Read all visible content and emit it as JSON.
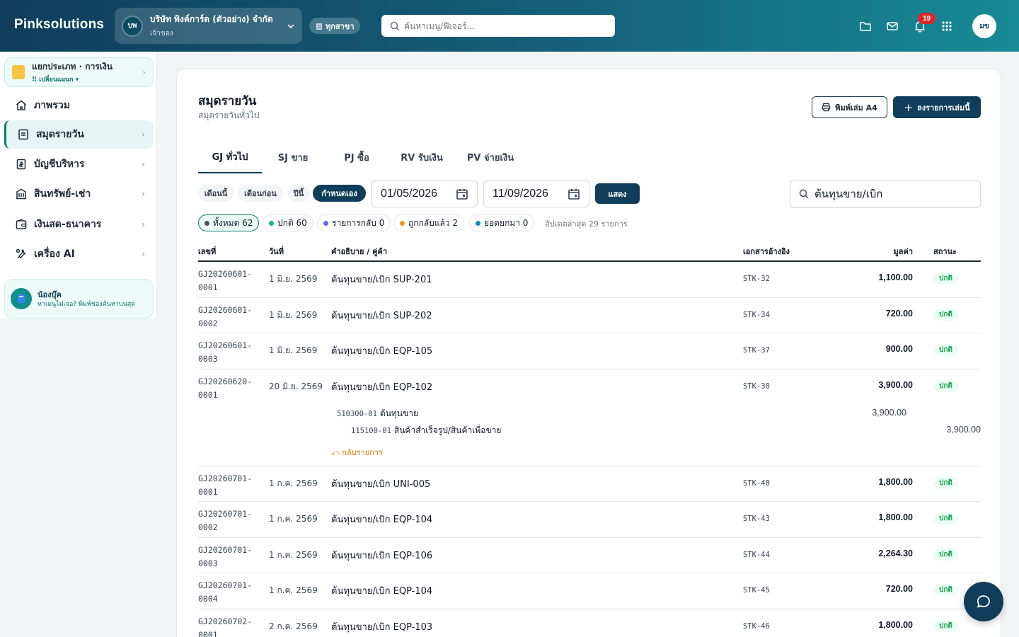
{
  "header": {
    "brand": "Pinksolutions",
    "company": {
      "badge": "บพ",
      "name": "บริษัท พิงค์การ์ด (ตัวอย่าง) จำกัด",
      "role": "เจ้าของ"
    },
    "branch_label": "ทุกสาขา",
    "search_placeholder": "ค้นหาเมนู/ฟีเจอร์...",
    "notification_count": "19",
    "avatar": "มข"
  },
  "sidebar": {
    "ledger": {
      "title": "แยกประเภท · การเงิน",
      "subtitle": "⠿ เปลี่ยนแผนก ▾"
    },
    "items": [
      {
        "label": "ภาพรวม",
        "icon": "home-icon",
        "active": false,
        "arrow": false
      },
      {
        "label": "สมุดรายวัน",
        "icon": "journal-icon",
        "active": true,
        "arrow": true
      },
      {
        "label": "บัญชีบริหาร",
        "icon": "ledger-icon",
        "active": false,
        "arrow": true
      },
      {
        "label": "สินทรัพย์-เช่า",
        "icon": "building-icon",
        "active": false,
        "arrow": true
      },
      {
        "label": "เงินสด-ธนาคาร",
        "icon": "wallet-icon",
        "active": false,
        "arrow": true
      },
      {
        "label": "เครื่อง AI",
        "icon": "tools-icon",
        "active": false,
        "arrow": true
      }
    ],
    "helper": {
      "title": "น้องบุ๊ค",
      "text": "หาเมนูไม่เจอ? พิมพ์ช่องค้นหาบนสุด"
    }
  },
  "main": {
    "title": "สมุดรายวัน",
    "subtitle": "สมุดรายวันทั่วไป",
    "print_label": "พิมพ์เล่ม A4",
    "add_label": "ลงรายการเล่มนี้",
    "tabs": [
      "GJ ทั่วไป",
      "SJ ขาย",
      "PJ ซื้อ",
      "RV รับเงิน",
      "PV จ่ายเงิน"
    ],
    "period_chips": [
      "เดือนนี้",
      "เดือนก่อน",
      "ปีนี้",
      "กำหนดเอง"
    ],
    "date_from": "01/05/2026",
    "date_to": "11/09/2026",
    "show_label": "แสดง",
    "search_value": "ต้นทุนขาย/เบิก",
    "status_filters": [
      {
        "label": "ทั้งหมด 62",
        "color": "#4b5563"
      },
      {
        "label": "ปกติ 60",
        "color": "#10b981"
      },
      {
        "label": "รายการกลับ 0",
        "color": "#6366f1"
      },
      {
        "label": "ถูกกลับแล้ว 2",
        "color": "#f59e0b"
      },
      {
        "label": "ยอดยกมา 0",
        "color": "#0891b2"
      }
    ],
    "updated_text": "อัปเดตล่าสุด 29 รายการ",
    "columns": {
      "no": "เลขที่",
      "date": "วันที่",
      "desc": "คำอธิบาย / คู่ค้า",
      "ref": "เอกสารอ้างอิง",
      "amount": "มูลค่า",
      "status": "สถานะ"
    },
    "rows": [
      {
        "no1": "GJ20260601-",
        "no2": "0001",
        "date": "1 มิ.ย. 2569",
        "desc": "ต้นทุนขาย/เบิก SUP-201",
        "ref": "STK-32",
        "amount": "1,100.00",
        "status": "ปกติ"
      },
      {
        "no1": "GJ20260601-",
        "no2": "0002",
        "date": "1 มิ.ย. 2569",
        "desc": "ต้นทุนขาย/เบิก SUP-202",
        "ref": "STK-34",
        "amount": "720.00",
        "status": "ปกติ"
      },
      {
        "no1": "GJ20260601-",
        "no2": "0003",
        "date": "1 มิ.ย. 2569",
        "desc": "ต้นทุนขาย/เบิก EQP-105",
        "ref": "STK-37",
        "amount": "900.00",
        "status": "ปกติ"
      },
      {
        "no1": "GJ20260620-",
        "no2": "0001",
        "date": "20 มิ.ย. 2569",
        "desc": "ต้นทุนขาย/เบิก EQP-102",
        "ref": "STK-30",
        "amount": "3,900.00",
        "status": "ปกติ",
        "lines": [
          {
            "acc": "510300-01",
            "name": "ต้นทุนขาย",
            "debit": "3,900.00"
          },
          {
            "acc": "115100-01",
            "name": "สินค้าสำเร็จรูป/สินค้าเพื่อขาย",
            "credit": "3,900.00"
          }
        ],
        "back_label": "⤺ กลับรายการ"
      },
      {
        "no1": "GJ20260701-",
        "no2": "0001",
        "date": "1 ก.ค. 2569",
        "desc": "ต้นทุนขาย/เบิก UNI-005",
        "ref": "STK-40",
        "amount": "1,800.00",
        "status": "ปกติ"
      },
      {
        "no1": "GJ20260701-",
        "no2": "0002",
        "date": "1 ก.ค. 2569",
        "desc": "ต้นทุนขาย/เบิก EQP-104",
        "ref": "STK-43",
        "amount": "1,800.00",
        "status": "ปกติ"
      },
      {
        "no1": "GJ20260701-",
        "no2": "0003",
        "date": "1 ก.ค. 2569",
        "desc": "ต้นทุนขาย/เบิก EQP-106",
        "ref": "STK-44",
        "amount": "2,264.30",
        "status": "ปกติ"
      },
      {
        "no1": "GJ20260701-",
        "no2": "0004",
        "date": "1 ก.ค. 2569",
        "desc": "ต้นทุนขาย/เบิก EQP-104",
        "ref": "STK-45",
        "amount": "720.00",
        "status": "ปกติ"
      },
      {
        "no1": "GJ20260702-",
        "no2": "0001",
        "date": "2 ก.ค. 2569",
        "desc": "ต้นทุนขาย/เบิก EQP-103",
        "ref": "STK-46",
        "amount": "1,800.00",
        "status": "ปกติ"
      }
    ]
  }
}
